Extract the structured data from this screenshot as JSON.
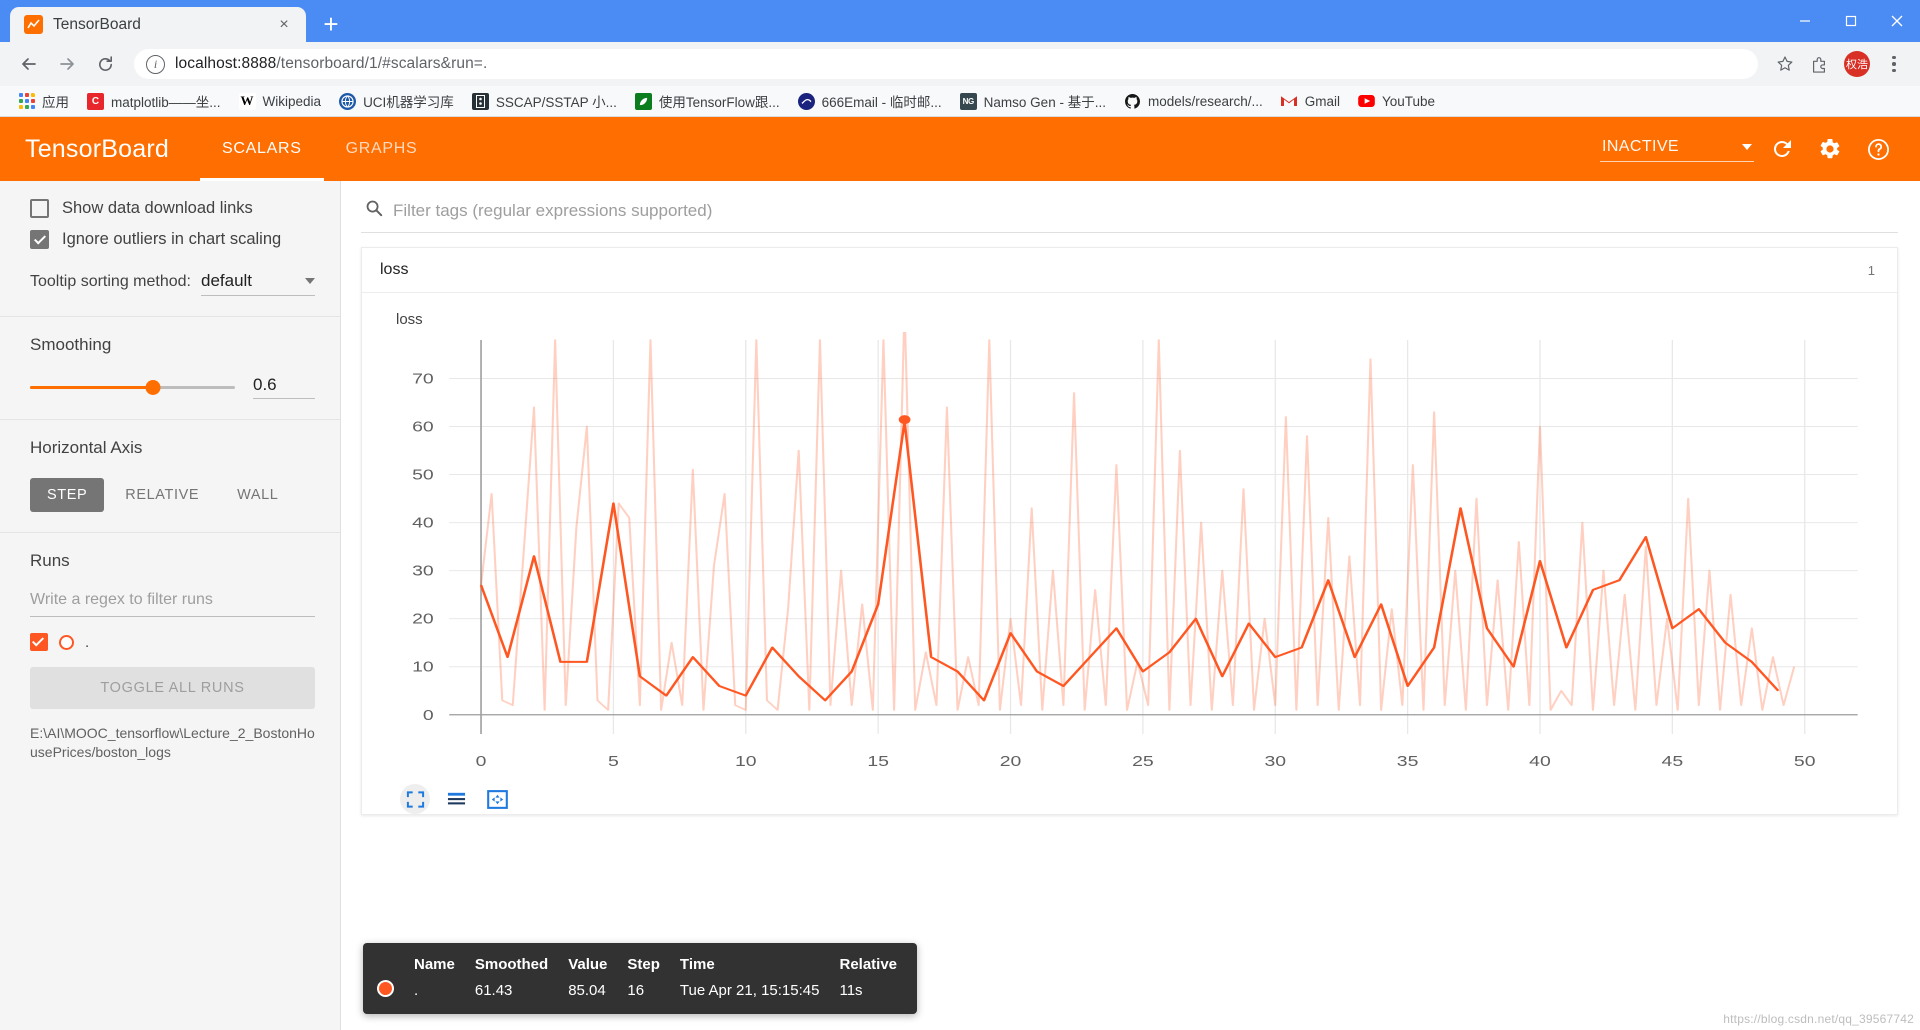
{
  "browser": {
    "tab": {
      "title": "TensorBoard",
      "favicon": "chart-icon",
      "close_label": "×"
    },
    "newtab_label": "+",
    "window_controls": {
      "minimize": "—",
      "maximize": "□",
      "close": "✕"
    },
    "nav": {
      "back": "←",
      "forward": "→",
      "reload": "⟳"
    },
    "omnibox": {
      "url_host": "localhost:8888",
      "url_path": "/tensorboard/1/#scalars&run=.",
      "full_url": "localhost:8888/tensorboard/1/#scalars&run=.",
      "info_glyph": "ⓘ",
      "star_glyph": "☆"
    },
    "profile_initials": "权浩",
    "bookmarks": [
      {
        "label": "应用",
        "icon": "apps-grid-icon"
      },
      {
        "label": "matplotlib——坐...",
        "icon": "c-icon",
        "color": "#e8272c"
      },
      {
        "label": "Wikipedia",
        "icon": "w-icon",
        "color": "#ffffff"
      },
      {
        "label": "UCI机器学习库",
        "icon": "globe-icon",
        "color": "#1e5aa8"
      },
      {
        "label": "SSCAP/SSTAP 小...",
        "icon": "app-icon",
        "color": "#263238"
      },
      {
        "label": "使用TensorFlow跟...",
        "icon": "leaf-icon",
        "color": "#0b7d1e"
      },
      {
        "label": "666Email - 临时邮...",
        "icon": "mail-globe-icon",
        "color": "#1a237e"
      },
      {
        "label": "Namso Gen - 基于...",
        "icon": "ng-icon",
        "color": "#37474f"
      },
      {
        "label": "models/research/...",
        "icon": "github-icon",
        "color": "#181717"
      },
      {
        "label": "Gmail",
        "icon": "gmail-icon",
        "color": "#d93025"
      },
      {
        "label": "YouTube",
        "icon": "youtube-icon",
        "color": "#ff0000"
      }
    ]
  },
  "tensorboard": {
    "logo": "TensorBoard",
    "tabs": [
      {
        "label": "SCALARS",
        "active": true
      },
      {
        "label": "GRAPHS",
        "active": false
      }
    ],
    "status_select": {
      "value": "INACTIVE"
    },
    "header_icons": {
      "refresh": "refresh-icon",
      "settings": "gear-icon",
      "help": "help-icon"
    },
    "sidebar": {
      "checkboxes": [
        {
          "label": "Show data download links",
          "checked": false
        },
        {
          "label": "Ignore outliers in chart scaling",
          "checked": true
        }
      ],
      "tooltip_sorting": {
        "label": "Tooltip sorting method:",
        "value": "default"
      },
      "smoothing": {
        "title": "Smoothing",
        "value": "0.6",
        "percent": 60
      },
      "horizontal_axis": {
        "title": "Horizontal Axis",
        "options": [
          {
            "label": "STEP",
            "active": true
          },
          {
            "label": "RELATIVE",
            "active": false
          },
          {
            "label": "WALL",
            "active": false
          }
        ]
      },
      "runs": {
        "title": "Runs",
        "filter_placeholder": "Write a regex to filter runs",
        "items": [
          {
            "name": ".",
            "checked": true,
            "color": "#ff5722"
          }
        ],
        "toggle_all_label": "TOGGLE ALL RUNS",
        "path": "E:\\AI\\MOOC_tensorflow\\Lecture_2_BostonHousePrices/boston_logs"
      }
    },
    "main": {
      "filter": {
        "placeholder": "Filter tags (regular expressions supported)",
        "icon": "search-icon"
      },
      "card": {
        "title": "loss",
        "count": "1"
      },
      "chart_tools": [
        {
          "name": "fit-domain-icon",
          "selected": true
        },
        {
          "name": "toggle-y-axis-icon",
          "selected": false
        },
        {
          "name": "expand-icon",
          "selected": false
        }
      ],
      "tooltip": {
        "headers": [
          "Name",
          "Smoothed",
          "Value",
          "Step",
          "Time",
          "Relative"
        ],
        "rows": [
          {
            "color": "#ff5722",
            "name": ".",
            "smoothed": "61.43",
            "value": "85.04",
            "step": "16",
            "time": "Tue Apr 21, 15:15:45",
            "relative": "11s"
          }
        ]
      },
      "watermark": "https://blog.csdn.net/qq_39567742"
    }
  },
  "chart_data": {
    "type": "line",
    "title": "loss",
    "xlabel": "",
    "ylabel": "",
    "xlim": [
      -1.2,
      52
    ],
    "ylim": [
      -4,
      78
    ],
    "xticks": [
      0,
      5,
      10,
      15,
      20,
      25,
      30,
      35,
      40,
      45,
      50
    ],
    "yticks": [
      0,
      10,
      20,
      30,
      40,
      50,
      60,
      70
    ],
    "grid": true,
    "legend": "none",
    "accent_color": "#ff5722",
    "highlight_point": {
      "step": 16,
      "value": 61.43,
      "raw_value": 85.04
    },
    "series": [
      {
        "name": ".",
        "kind": "raw",
        "color": "#ff5722",
        "opacity": 0.28,
        "x": [
          0,
          0.4,
          0.8,
          1.2,
          1.6,
          2,
          2.4,
          2.8,
          3.2,
          3.6,
          4,
          4.4,
          4.8,
          5.2,
          5.6,
          6,
          6.4,
          6.8,
          7.2,
          7.6,
          8,
          8.4,
          8.8,
          9.2,
          9.6,
          10,
          10.4,
          10.8,
          11.2,
          11.6,
          12,
          12.4,
          12.8,
          13.2,
          13.6,
          14,
          14.4,
          14.8,
          15.2,
          15.6,
          16,
          16.4,
          16.8,
          17.2,
          17.6,
          18,
          18.4,
          18.8,
          19.2,
          19.6,
          20,
          20.4,
          20.8,
          21.2,
          21.6,
          22,
          22.4,
          22.8,
          23.2,
          23.6,
          24,
          24.4,
          24.8,
          25.2,
          25.6,
          26,
          26.4,
          26.8,
          27.2,
          27.6,
          28,
          28.4,
          28.8,
          29.2,
          29.6,
          30,
          30.4,
          30.8,
          31.2,
          31.6,
          32,
          32.4,
          32.8,
          33.2,
          33.6,
          34,
          34.4,
          34.8,
          35.2,
          35.6,
          36,
          36.4,
          36.8,
          37.2,
          37.6,
          38,
          38.4,
          38.8,
          39.2,
          39.6,
          40,
          40.4,
          40.8,
          41.2,
          41.6,
          42,
          42.4,
          42.8,
          43.2,
          43.6,
          44,
          44.4,
          44.8,
          45.2,
          45.6,
          46,
          46.4,
          46.8,
          47.2,
          47.6,
          48,
          48.4,
          48.8,
          49.2,
          49.6
        ],
        "y": [
          27,
          46,
          3,
          2,
          33,
          64,
          1,
          78,
          2,
          39,
          60,
          3,
          1,
          44,
          41,
          2,
          78,
          1,
          15,
          2,
          51,
          1,
          31,
          46,
          2,
          1,
          78,
          3,
          1,
          22,
          55,
          1,
          78,
          2,
          30,
          2,
          23,
          1,
          78,
          1,
          85,
          1,
          13,
          2,
          64,
          1,
          12,
          2,
          78,
          1,
          20,
          2,
          43,
          1,
          30,
          2,
          67,
          1,
          26,
          2,
          52,
          1,
          11,
          2,
          78,
          1,
          55,
          2,
          40,
          1,
          30,
          2,
          47,
          1,
          20,
          2,
          62,
          1,
          58,
          2,
          41,
          1,
          33,
          2,
          74,
          1,
          22,
          2,
          52,
          1,
          63,
          2,
          30,
          1,
          45,
          2,
          28,
          1,
          36,
          2,
          60,
          1,
          5,
          2,
          40,
          1,
          30,
          2,
          25,
          1,
          35,
          2,
          20,
          1,
          45,
          2,
          30,
          1,
          25,
          2,
          18,
          1,
          12,
          2,
          10,
          1,
          6,
          2,
          5
        ]
      },
      {
        "name": ".",
        "kind": "smoothed",
        "color": "#ff5722",
        "opacity": 1,
        "x": [
          0,
          1,
          2,
          3,
          4,
          5,
          6,
          7,
          8,
          9,
          10,
          11,
          12,
          13,
          14,
          15,
          16,
          17,
          18,
          19,
          20,
          21,
          22,
          23,
          24,
          25,
          26,
          27,
          28,
          29,
          30,
          31,
          32,
          33,
          34,
          35,
          36,
          37,
          38,
          39,
          40,
          41,
          42,
          43,
          44,
          45,
          46,
          47,
          48,
          49
        ],
        "y": [
          27,
          12,
          33,
          11,
          11,
          44,
          8,
          4,
          12,
          6,
          4,
          14,
          8,
          3,
          9,
          23,
          61,
          12,
          9,
          3,
          17,
          9,
          6,
          12,
          18,
          9,
          13,
          20,
          8,
          19,
          12,
          14,
          28,
          12,
          23,
          6,
          14,
          43,
          18,
          10,
          32,
          14,
          26,
          28,
          37,
          18,
          22,
          15,
          11,
          5
        ]
      }
    ]
  }
}
